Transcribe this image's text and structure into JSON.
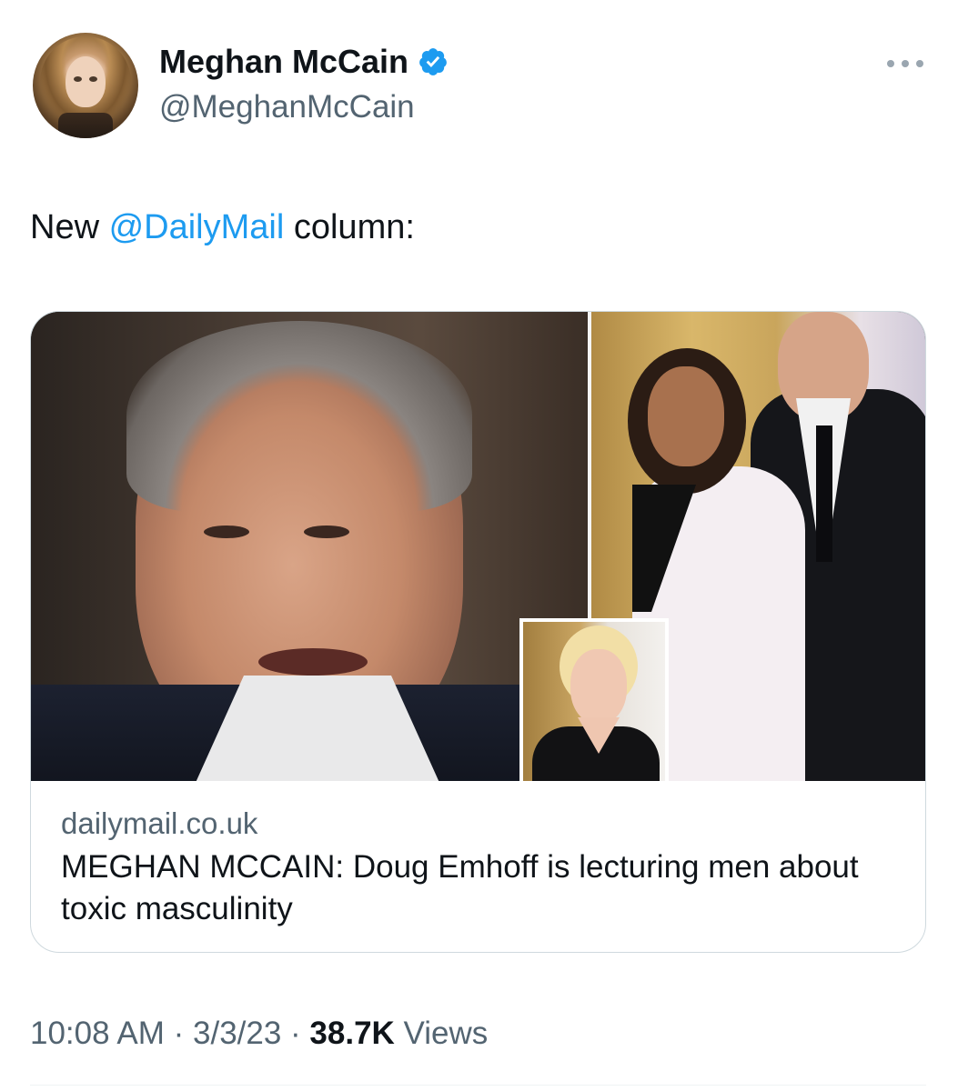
{
  "author": {
    "display_name": "Meghan McCain",
    "handle": "@MeghanMcCain",
    "verified": true,
    "avatar_icon": "avatar-photo"
  },
  "tweet": {
    "text_prefix": "New ",
    "mention": "@DailyMail",
    "text_suffix": " column:",
    "mention_color": "#1d9bf0"
  },
  "card": {
    "domain": "dailymail.co.uk",
    "title": "MEGHAN MCCAIN: Doug Emhoff is lecturing men about toxic masculinity"
  },
  "meta": {
    "time": "10:08 AM",
    "sep1": " · ",
    "date": "3/3/23",
    "sep2": " · ",
    "views_count": "38.7K",
    "views_label": " Views"
  },
  "icons": {
    "verified": "verified-badge-icon",
    "more": "more-options-icon"
  },
  "colors": {
    "verified_blue": "#1d9bf0",
    "secondary_text": "#536471",
    "primary_text": "#0f1419",
    "border": "#cfd9de"
  }
}
